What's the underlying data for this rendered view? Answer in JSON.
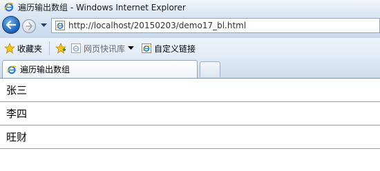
{
  "window": {
    "title": "遍历输出数组 - Windows Internet Explorer"
  },
  "navigation": {
    "back_icon": "back-arrow-icon",
    "forward_icon": "forward-arrow-icon",
    "url": "http://localhost/20150203/demo17_bl.html"
  },
  "favorites_bar": {
    "favorites_label": "收藏夹",
    "web_slices_label": "网页快讯库",
    "custom_links_label": "自定义链接"
  },
  "tabs": [
    {
      "label": "遍历输出数组"
    }
  ],
  "content": {
    "rows": [
      "张三",
      "李四",
      "旺财"
    ]
  },
  "colors": {
    "accent": "#1a5fb6",
    "row_border": "#9a9a9a"
  }
}
